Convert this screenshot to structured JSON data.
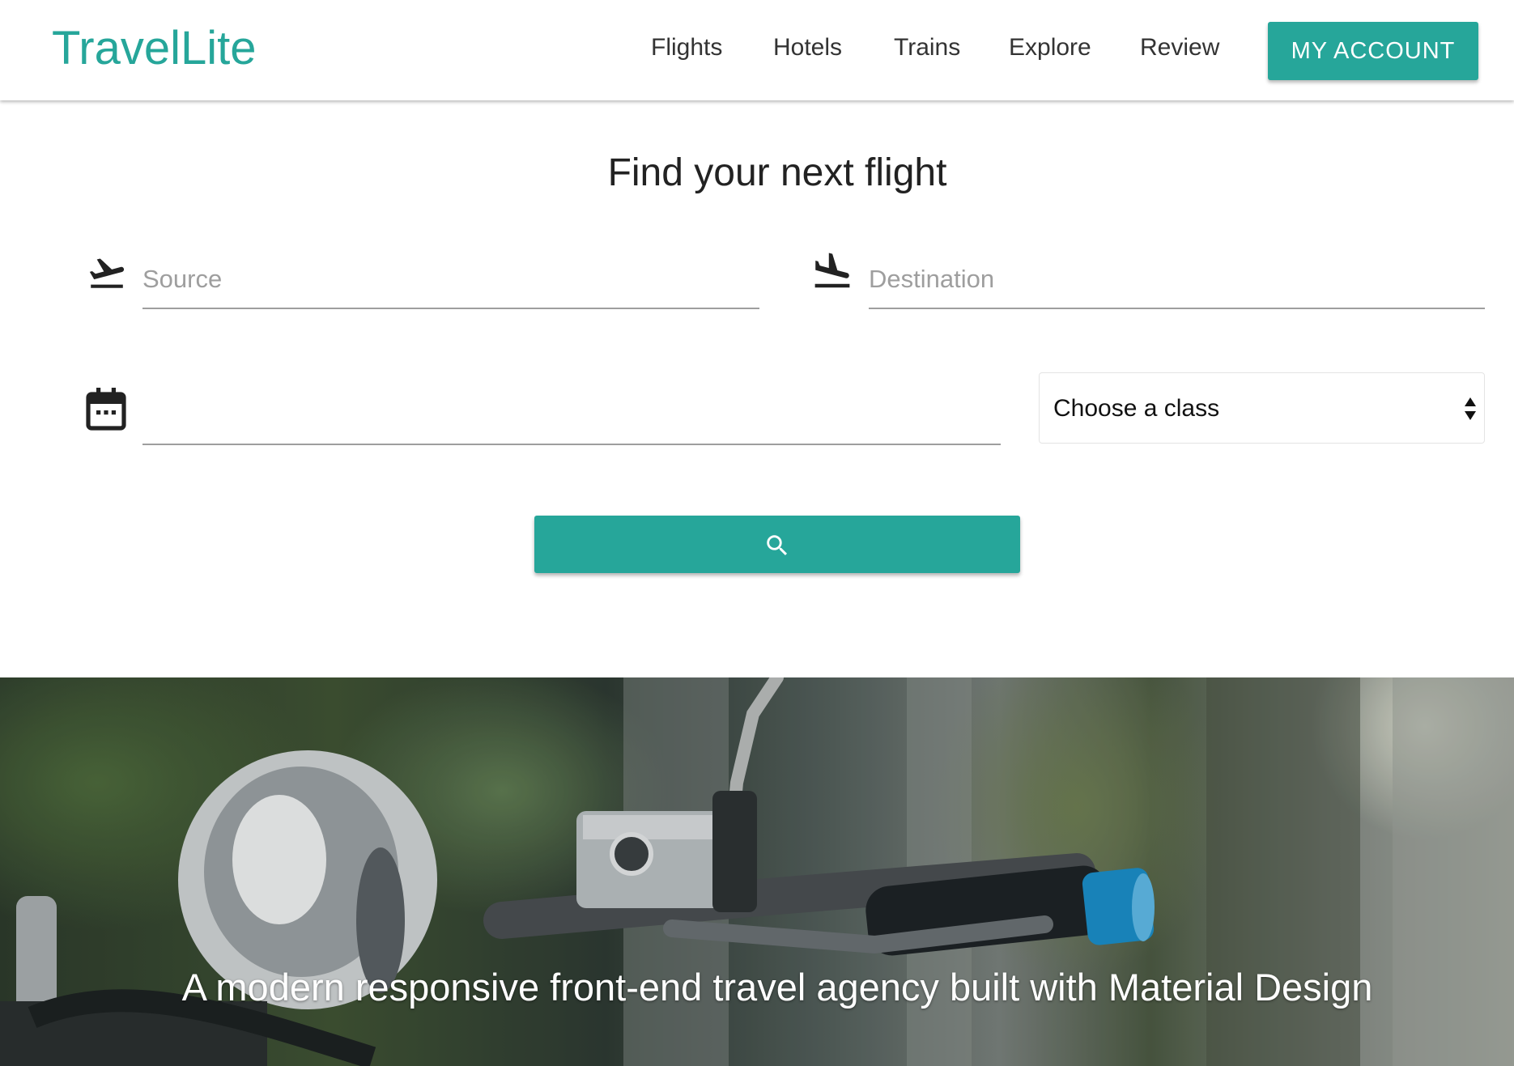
{
  "brand": {
    "name": "TravelLite",
    "color": "#26a69a"
  },
  "nav": {
    "links": [
      "Flights",
      "Hotels",
      "Trains",
      "Explore",
      "Review"
    ],
    "account_label": "MY ACCOUNT"
  },
  "search": {
    "title": "Find your next flight",
    "source": {
      "placeholder": "Source",
      "value": "",
      "icon": "flight-takeoff-icon"
    },
    "destination": {
      "placeholder": "Destination",
      "value": "",
      "icon": "flight-land-icon"
    },
    "date": {
      "value": "",
      "icon": "calendar-icon"
    },
    "class_select": {
      "selected": "Choose a class",
      "icon": "select-arrows-icon"
    },
    "search_button": {
      "icon": "search-icon"
    }
  },
  "hero": {
    "tagline": "A modern responsive front-end travel agency built with Material Design",
    "image": "motorcycle-handlebar-photo"
  }
}
